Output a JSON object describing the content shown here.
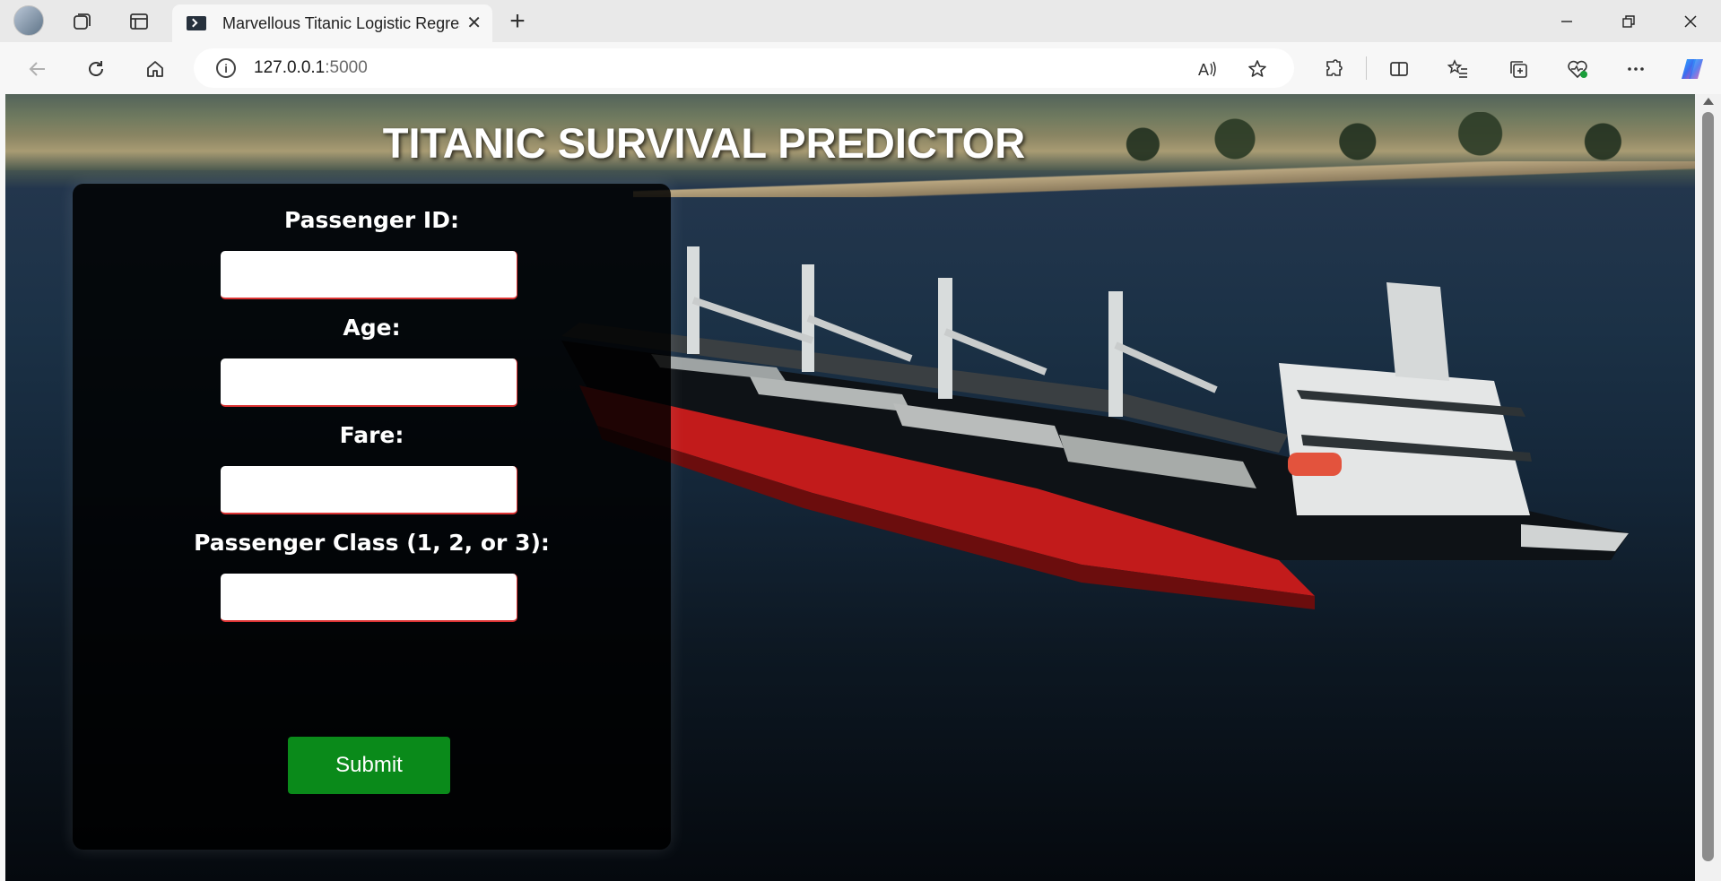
{
  "browser": {
    "tab_title": "Marvellous Titanic Logistic Regression",
    "url_host": "127.0.0.1",
    "url_port": ":5000"
  },
  "page": {
    "title": "TITANIC SURVIVAL PREDICTOR",
    "fields": [
      {
        "label": "Passenger ID:",
        "value": ""
      },
      {
        "label": "Age:",
        "value": ""
      },
      {
        "label": "Fare:",
        "value": ""
      },
      {
        "label": "Passenger Class (1, 2, or 3):",
        "value": ""
      }
    ],
    "submit_label": "Submit"
  },
  "colors": {
    "submit_bg": "#0a8a1a",
    "card_bg": "#000000",
    "input_border": "#dd3333"
  }
}
